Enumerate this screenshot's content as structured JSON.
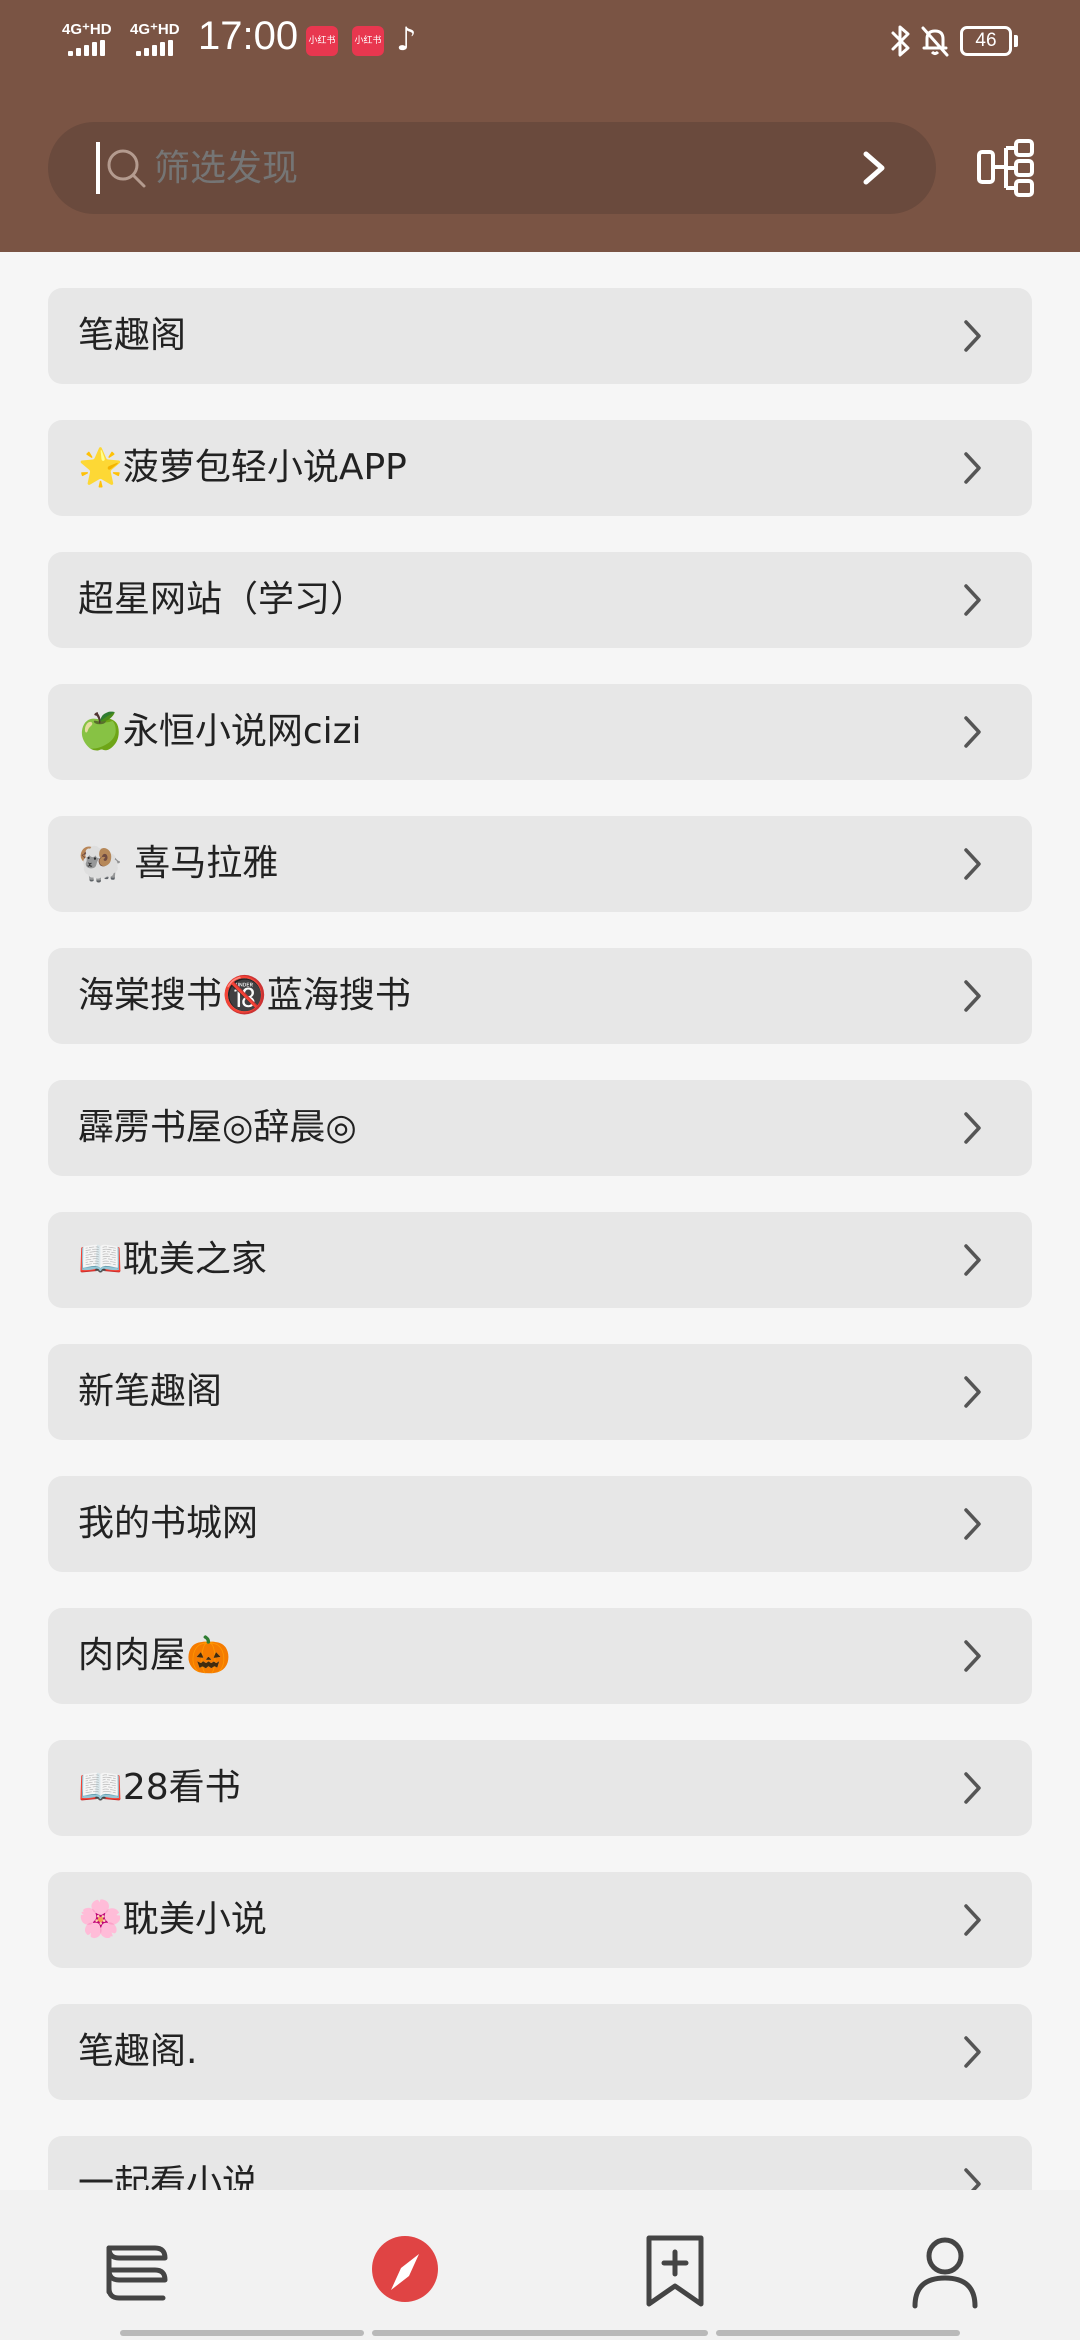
{
  "status_bar": {
    "signal1_label": "4G⁺HD",
    "signal2_label": "4G⁺HD",
    "time": "17:00",
    "app_badge_1": "小红书",
    "app_badge_2": "小红书",
    "battery": "46"
  },
  "search": {
    "placeholder": "筛选发现"
  },
  "sources": [
    {
      "label": "笔趣阁"
    },
    {
      "label": "🌟菠萝包轻小说APP"
    },
    {
      "label": "超星网站（学习）"
    },
    {
      "label": "🍏永恒小说网cizi"
    },
    {
      "label": "🐏 喜马拉雅"
    },
    {
      "label": "海棠搜书🔞蓝海搜书"
    },
    {
      "label": "霹雳书屋◎辞晨◎"
    },
    {
      "label": "📖耽美之家"
    },
    {
      "label": "新笔趣阁"
    },
    {
      "label": "我的书城网"
    },
    {
      "label": "肉肉屋🎃"
    },
    {
      "label": "📖28看书"
    },
    {
      "label": "🌸耽美小说"
    },
    {
      "label": "笔趣阁."
    },
    {
      "label": "一起看小说"
    }
  ],
  "colors": {
    "header": "#7a5444",
    "search_bg": "#6a4a3d",
    "row_bg": "#e7e7e7",
    "accent": "#e04444"
  },
  "icons": {
    "nav": [
      "bookshelf-icon",
      "discover-compass-icon",
      "bookmark-add-icon",
      "profile-icon"
    ]
  }
}
